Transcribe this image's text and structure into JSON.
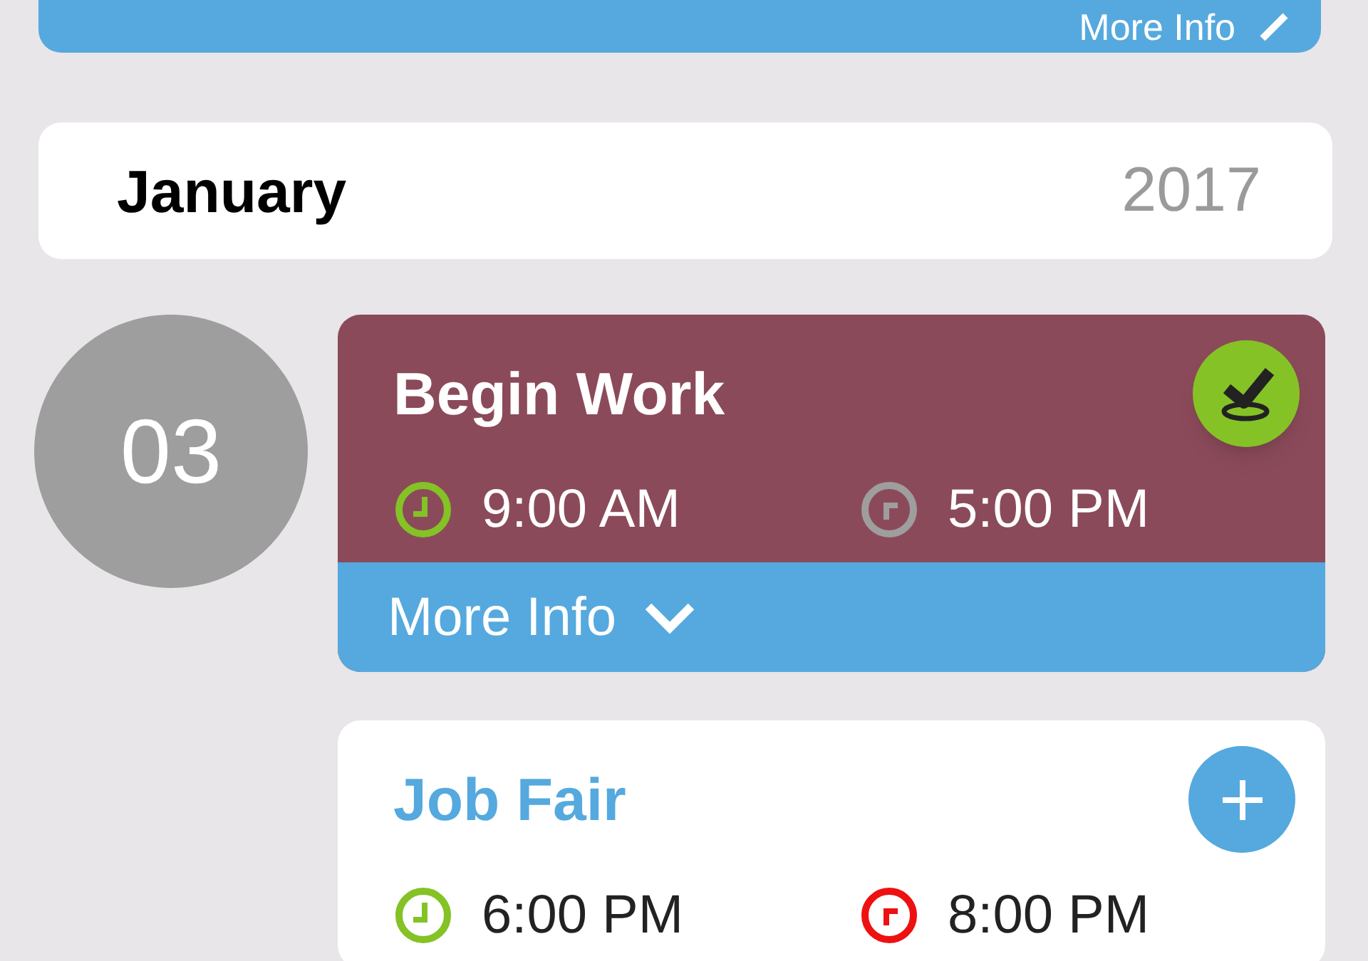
{
  "top_bar": {
    "label": "More Info"
  },
  "month_header": {
    "month": "January",
    "year": "2017"
  },
  "day": {
    "date": "03",
    "events": [
      {
        "kind": "filled",
        "title": "Begin Work",
        "color": "#8b4a5a",
        "completed": true,
        "times": [
          {
            "text": "9:00 AM",
            "color": "#84c225"
          },
          {
            "text": "5:00 PM",
            "color": "#9e9e9e"
          }
        ],
        "more_info": "More Info",
        "expanded": false
      },
      {
        "kind": "plain",
        "title": "Job Fair",
        "color": "#ffffff",
        "completed": false,
        "times": [
          {
            "text": "6:00 PM",
            "color": "#84c225"
          },
          {
            "text": "8:00 PM",
            "color": "#ee1111"
          }
        ]
      }
    ]
  }
}
